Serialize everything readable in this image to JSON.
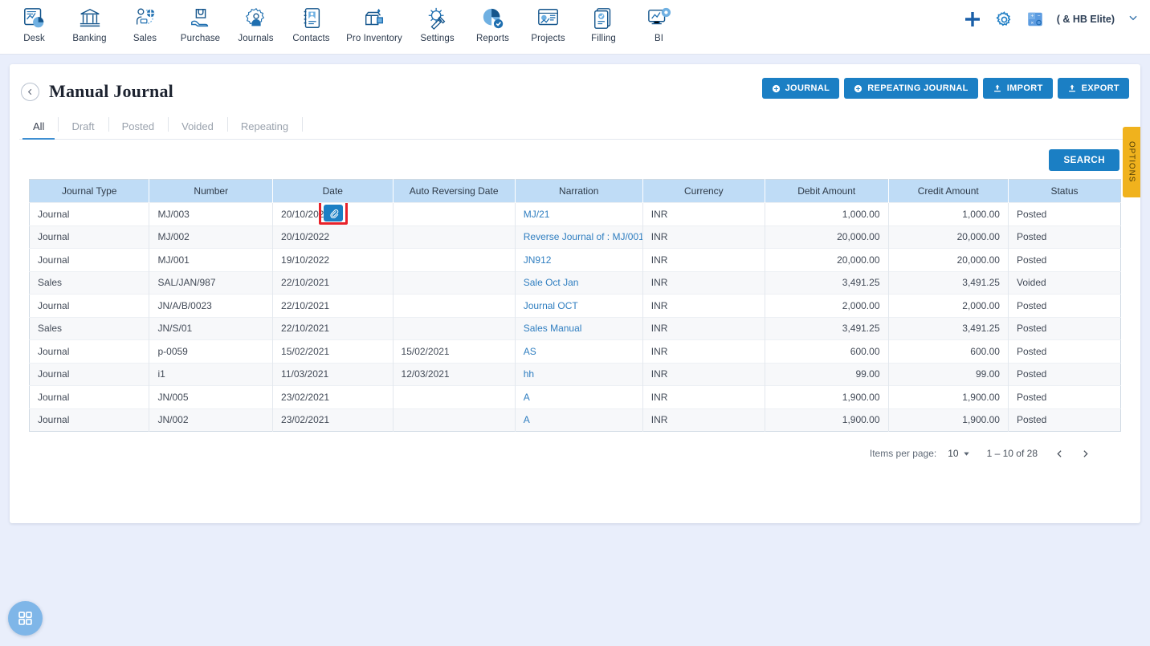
{
  "topnav": {
    "items": [
      {
        "label": "Desk",
        "icon": "dashboard-icon"
      },
      {
        "label": "Banking",
        "icon": "bank-icon"
      },
      {
        "label": "Sales",
        "icon": "sales-icon"
      },
      {
        "label": "Purchase",
        "icon": "purchase-icon"
      },
      {
        "label": "Journals",
        "icon": "journals-icon"
      },
      {
        "label": "Contacts",
        "icon": "contacts-icon"
      },
      {
        "label": "Pro Inventory",
        "icon": "inventory-icon"
      },
      {
        "label": "Settings",
        "icon": "settings-tools-icon"
      },
      {
        "label": "Reports",
        "icon": "reports-icon"
      },
      {
        "label": "Projects",
        "icon": "projects-icon"
      },
      {
        "label": "Filling",
        "icon": "filling-icon"
      },
      {
        "label": "BI",
        "icon": "bi-icon"
      }
    ],
    "right": {
      "add_icon": "plus-icon",
      "settings_icon": "gear-icon",
      "calculator_icon": "calculator-icon",
      "user_name": "( & HB Elite)",
      "chevron_icon": "chevron-down-icon"
    }
  },
  "header": {
    "back_icon": "chevron-left-icon",
    "title": "Manual Journal",
    "actions": [
      {
        "label": "JOURNAL",
        "icon": "plus-circle-icon"
      },
      {
        "label": "REPEATING JOURNAL",
        "icon": "plus-circle-icon"
      },
      {
        "label": "IMPORT",
        "icon": "upload-icon"
      },
      {
        "label": "EXPORT",
        "icon": "upload-icon"
      }
    ]
  },
  "tabs": [
    {
      "label": "All",
      "active": true
    },
    {
      "label": "Draft",
      "active": false
    },
    {
      "label": "Posted",
      "active": false
    },
    {
      "label": "Voided",
      "active": false
    },
    {
      "label": "Repeating",
      "active": false
    }
  ],
  "search": {
    "label": "SEARCH"
  },
  "options_tab": {
    "label": "OPTIONS"
  },
  "table": {
    "columns": [
      "Journal Type",
      "Number",
      "Date",
      "Auto Reversing Date",
      "Narration",
      "Currency",
      "Debit Amount",
      "Credit Amount",
      "Status"
    ],
    "rows": [
      {
        "journal_type": "Journal",
        "number": "MJ/003",
        "date": "20/10/2022",
        "auto_reversing_date": "",
        "narration": "MJ/21",
        "currency": "INR",
        "debit": "1,000.00",
        "credit": "1,000.00",
        "status": "Posted",
        "attachment": true,
        "highlighted": true
      },
      {
        "journal_type": "Journal",
        "number": "MJ/002",
        "date": "20/10/2022",
        "auto_reversing_date": "",
        "narration": "Reverse Journal of : MJ/001",
        "currency": "INR",
        "debit": "20,000.00",
        "credit": "20,000.00",
        "status": "Posted",
        "attachment": false,
        "highlighted": false
      },
      {
        "journal_type": "Journal",
        "number": "MJ/001",
        "date": "19/10/2022",
        "auto_reversing_date": "",
        "narration": "JN912",
        "currency": "INR",
        "debit": "20,000.00",
        "credit": "20,000.00",
        "status": "Posted",
        "attachment": false,
        "highlighted": false
      },
      {
        "journal_type": "Sales",
        "number": "SAL/JAN/987",
        "date": "22/10/2021",
        "auto_reversing_date": "",
        "narration": "Sale Oct Jan",
        "currency": "INR",
        "debit": "3,491.25",
        "credit": "3,491.25",
        "status": "Voided",
        "attachment": false,
        "highlighted": false
      },
      {
        "journal_type": "Journal",
        "number": "JN/A/B/0023",
        "date": "22/10/2021",
        "auto_reversing_date": "",
        "narration": "Journal OCT",
        "currency": "INR",
        "debit": "2,000.00",
        "credit": "2,000.00",
        "status": "Posted",
        "attachment": false,
        "highlighted": false
      },
      {
        "journal_type": "Sales",
        "number": "JN/S/01",
        "date": "22/10/2021",
        "auto_reversing_date": "",
        "narration": "Sales Manual",
        "currency": "INR",
        "debit": "3,491.25",
        "credit": "3,491.25",
        "status": "Posted",
        "attachment": false,
        "highlighted": false
      },
      {
        "journal_type": "Journal",
        "number": "p-0059",
        "date": "15/02/2021",
        "auto_reversing_date": "15/02/2021",
        "narration": "AS",
        "currency": "INR",
        "debit": "600.00",
        "credit": "600.00",
        "status": "Posted",
        "attachment": false,
        "highlighted": false
      },
      {
        "journal_type": "Journal",
        "number": "i1",
        "date": "11/03/2021",
        "auto_reversing_date": "12/03/2021",
        "narration": "hh",
        "currency": "INR",
        "debit": "99.00",
        "credit": "99.00",
        "status": "Posted",
        "attachment": false,
        "highlighted": false
      },
      {
        "journal_type": "Journal",
        "number": "JN/005",
        "date": "23/02/2021",
        "auto_reversing_date": "",
        "narration": "A",
        "currency": "INR",
        "debit": "1,900.00",
        "credit": "1,900.00",
        "status": "Posted",
        "attachment": false,
        "highlighted": false
      },
      {
        "journal_type": "Journal",
        "number": "JN/002",
        "date": "23/02/2021",
        "auto_reversing_date": "",
        "narration": "A",
        "currency": "INR",
        "debit": "1,900.00",
        "credit": "1,900.00",
        "status": "Posted",
        "attachment": false,
        "highlighted": false
      }
    ]
  },
  "pagination": {
    "items_per_page_label": "Items per page:",
    "items_per_page_value": "10",
    "range": "1 – 10 of 28",
    "prev_icon": "chevron-left-icon",
    "next_icon": "chevron-right-icon"
  },
  "fab": {
    "icon": "grid-apps-icon"
  },
  "colors": {
    "accent": "#1b7fc4",
    "page_bg": "#e9eefb",
    "table_header": "#bfdcf6",
    "options_tab": "#f0b21d",
    "highlight": "#e8222a"
  }
}
